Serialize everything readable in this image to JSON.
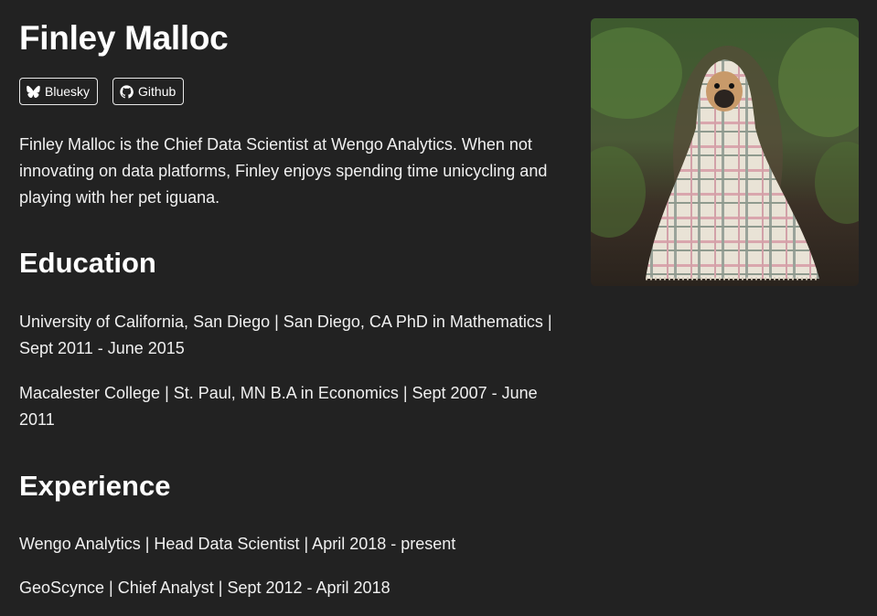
{
  "profile": {
    "name": "Finley Malloc",
    "bio": "Finley Malloc is the Chief Data Scientist at Wengo Analytics. When not innovating on data platforms, Finley enjoys spending time unicycling and playing with her pet iguana."
  },
  "links": {
    "bluesky": {
      "label": "Bluesky",
      "icon": "butterfly-icon"
    },
    "github": {
      "label": "Github",
      "icon": "github-icon"
    }
  },
  "education": {
    "title": "Education",
    "items": [
      "University of California, San Diego | San Diego, CA PhD in Mathematics | Sept 2011 - June 2015",
      "Macalester College | St. Paul, MN B.A in Economics | Sept 2007 - June 2011"
    ]
  },
  "experience": {
    "title": "Experience",
    "items": [
      "Wengo Analytics | Head Data Scientist | April 2018 - present",
      "GeoScynce | Chief Analyst | Sept 2012 - April 2018"
    ]
  },
  "photo": {
    "subject": "pug wrapped in plaid blanket on forest path"
  },
  "colors": {
    "background": "#222222",
    "text": "#f2f2f2"
  }
}
